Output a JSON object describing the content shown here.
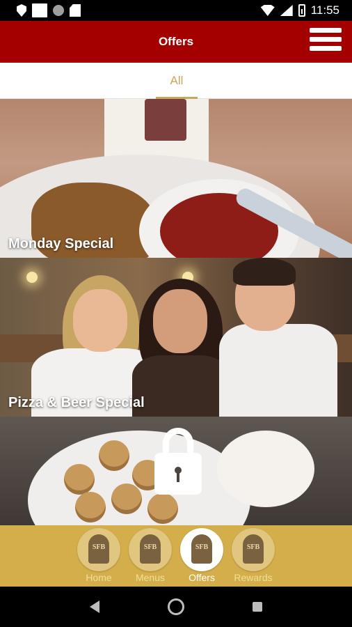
{
  "status_bar": {
    "time": "11:55"
  },
  "app_bar": {
    "title": "Offers"
  },
  "tabs": [
    {
      "label": "All",
      "active": true
    }
  ],
  "offers": [
    {
      "title": "Monday Special",
      "locked": false
    },
    {
      "title": "Pizza & Beer Special",
      "locked": false
    },
    {
      "title": "",
      "locked": true
    }
  ],
  "bottom_nav": {
    "items": [
      {
        "label": "Home"
      },
      {
        "label": "Menus"
      },
      {
        "label": "Offers"
      },
      {
        "label": "Rewards"
      }
    ],
    "active": "Offers"
  },
  "colors": {
    "primary": "#a50000",
    "accent": "#caa55a",
    "nav_bg": "#d3ae4a"
  },
  "icons": [
    "shield-icon",
    "square-icon",
    "circle-icon",
    "sd-card-icon",
    "wifi-icon",
    "signal-icon",
    "battery-icon",
    "menu-icon",
    "lock-icon",
    "sfb-logo-icon",
    "back-icon",
    "home-icon",
    "recents-icon"
  ]
}
